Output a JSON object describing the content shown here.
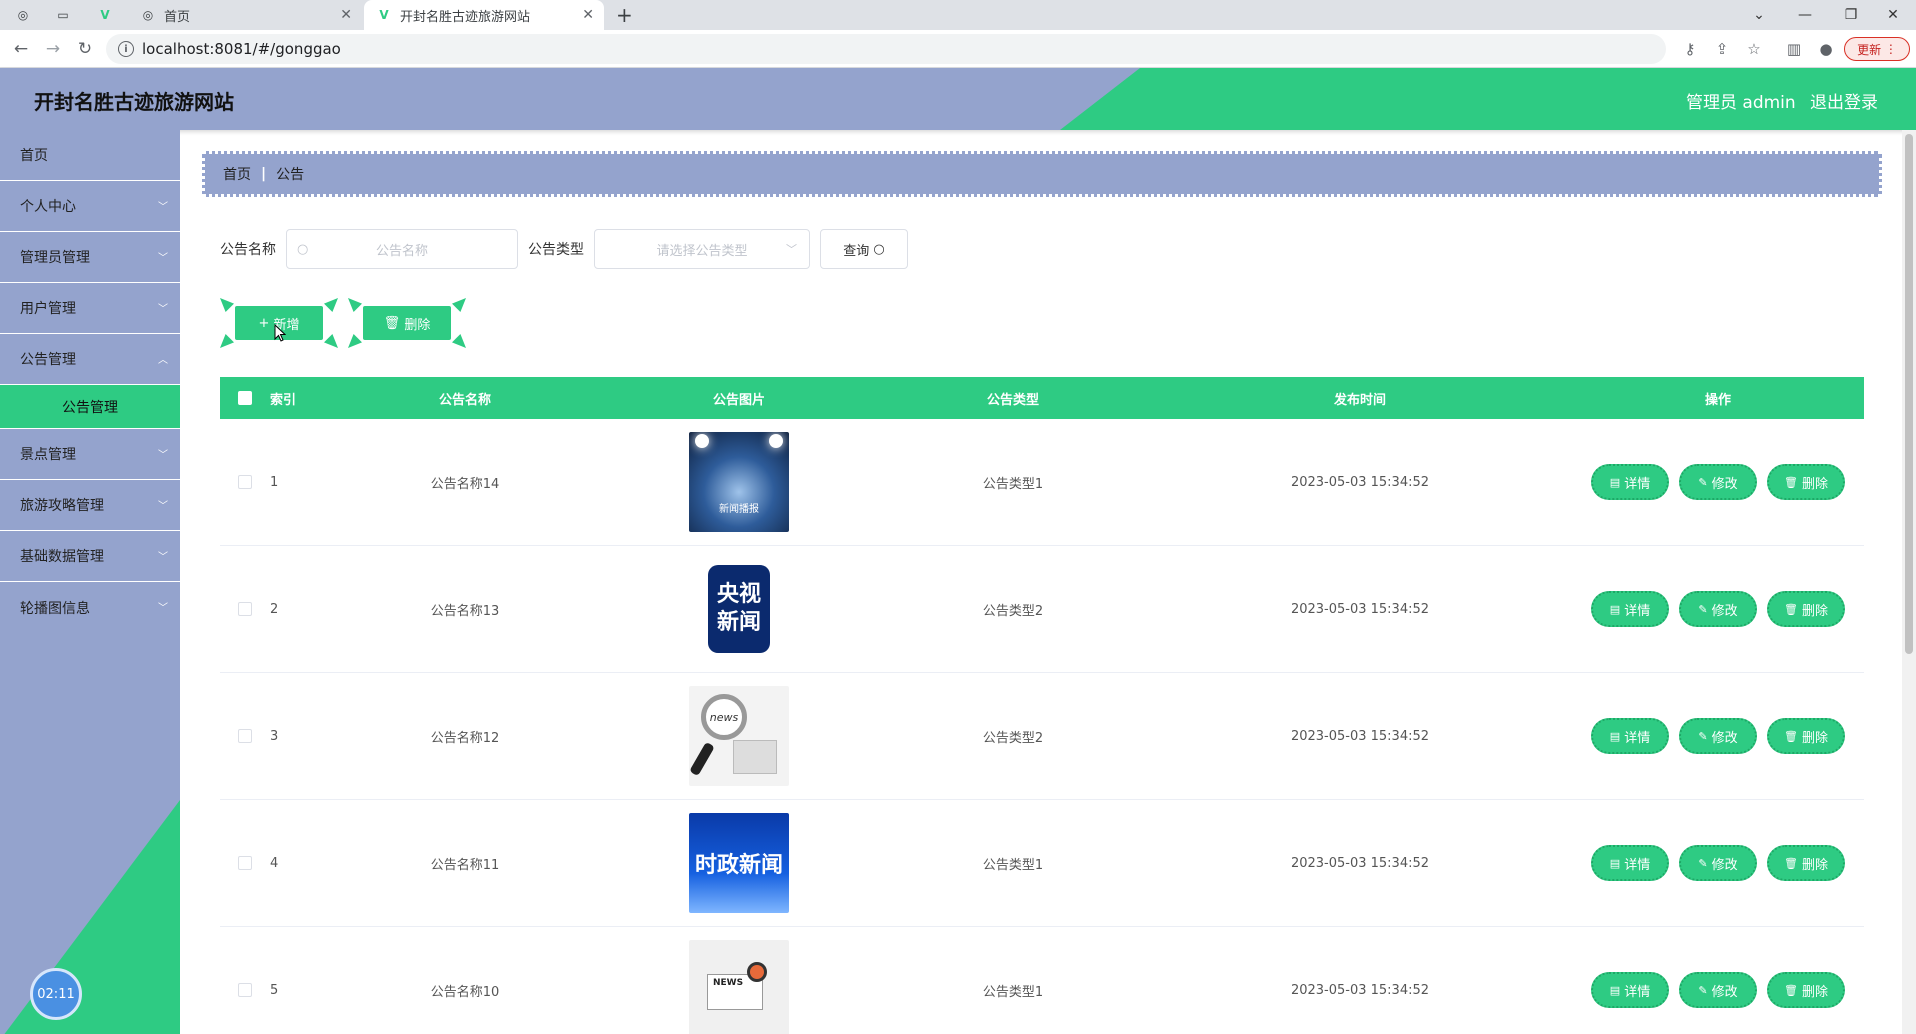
{
  "browser": {
    "tabs": [
      {
        "label": "首页",
        "icon": "globe-icon"
      },
      {
        "label": "开封名胜古迹旅游网站",
        "icon": "vue-icon"
      }
    ],
    "url": "localhost:8081/#/gonggao",
    "update_label": "更新"
  },
  "header": {
    "title": "开封名胜古迹旅游网站",
    "user": "管理员 admin",
    "logout": "退出登录"
  },
  "sidebar": {
    "items": [
      {
        "label": "首页"
      },
      {
        "label": "个人中心"
      },
      {
        "label": "管理员管理"
      },
      {
        "label": "用户管理"
      },
      {
        "label": "公告管理"
      },
      {
        "label": "公告管理"
      },
      {
        "label": "景点管理"
      },
      {
        "label": "旅游攻略管理"
      },
      {
        "label": "基础数据管理"
      },
      {
        "label": "轮播图信息"
      }
    ],
    "clock": "02:11"
  },
  "breadcrumb": {
    "home": "首页",
    "current": "公告"
  },
  "search": {
    "name_label": "公告名称",
    "name_placeholder": "公告名称",
    "type_label": "公告类型",
    "type_placeholder": "请选择公告类型",
    "query_label": "查询"
  },
  "actions": {
    "add": "新增",
    "delete": "删除"
  },
  "table": {
    "columns": [
      "索引",
      "公告名称",
      "公告图片",
      "公告类型",
      "发布时间",
      "操作"
    ],
    "rows": [
      {
        "index": "1",
        "name": "公告名称14",
        "type": "公告类型1",
        "time": "2023-05-03 15:34:52",
        "image": "stage-spotlight-image",
        "image_text": "新闻播报"
      },
      {
        "index": "2",
        "name": "公告名称13",
        "type": "公告类型2",
        "time": "2023-05-03 15:34:52",
        "image": "cctv-news-logo",
        "image_text": "央视新闻"
      },
      {
        "index": "3",
        "name": "公告名称12",
        "type": "公告类型2",
        "time": "2023-05-03 15:34:52",
        "image": "magnifier-news-image",
        "image_text": "news"
      },
      {
        "index": "4",
        "name": "公告名称11",
        "type": "公告类型1",
        "time": "2023-05-03 15:34:52",
        "image": "politics-news-image",
        "image_text": "时政新闻"
      },
      {
        "index": "5",
        "name": "公告名称10",
        "type": "公告类型1",
        "time": "2023-05-03 15:34:52",
        "image": "news-clipart-image",
        "image_text": "NEWS"
      }
    ],
    "ops": {
      "detail": "详情",
      "edit": "修改",
      "delete": "删除"
    }
  },
  "colors": {
    "accent": "#2ecb83",
    "sidebar": "#94a3cd"
  }
}
